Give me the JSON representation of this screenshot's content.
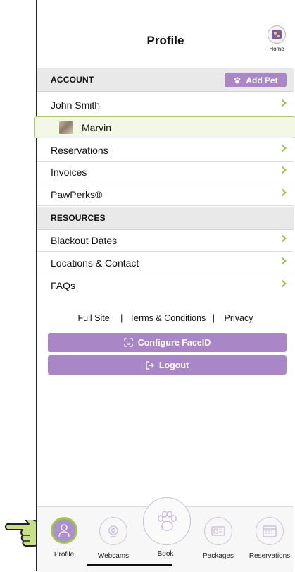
{
  "header": {
    "title": "Profile",
    "home_label": "Home"
  },
  "account": {
    "heading": "ACCOUNT",
    "add_pet_label": "Add Pet",
    "items": [
      {
        "label": "John Smith"
      },
      {
        "label": "Marvin"
      },
      {
        "label": "Reservations"
      },
      {
        "label": "Invoices"
      },
      {
        "label": "PawPerks®"
      }
    ]
  },
  "resources": {
    "heading": "RESOURCES",
    "items": [
      {
        "label": "Blackout Dates"
      },
      {
        "label": "Locations & Contact"
      },
      {
        "label": "FAQs"
      }
    ]
  },
  "links": {
    "full_site": "Full Site",
    "sep1": "|",
    "terms": "Terms & Conditions",
    "sep2": "|",
    "privacy": "Privacy"
  },
  "buttons": {
    "faceid": "Configure FaceID",
    "logout": "Logout"
  },
  "tabs": [
    {
      "label": "Profile",
      "icon": "profile-icon"
    },
    {
      "label": "Webcams",
      "icon": "webcam-icon"
    },
    {
      "label": "Book",
      "icon": "paw-icon"
    },
    {
      "label": "Packages",
      "icon": "package-icon"
    },
    {
      "label": "Reservations",
      "icon": "calendar-icon"
    }
  ],
  "colors": {
    "accent_purple": "#a987c6",
    "accent_green": "#96c24a",
    "section_bg": "#e9e9ea"
  }
}
